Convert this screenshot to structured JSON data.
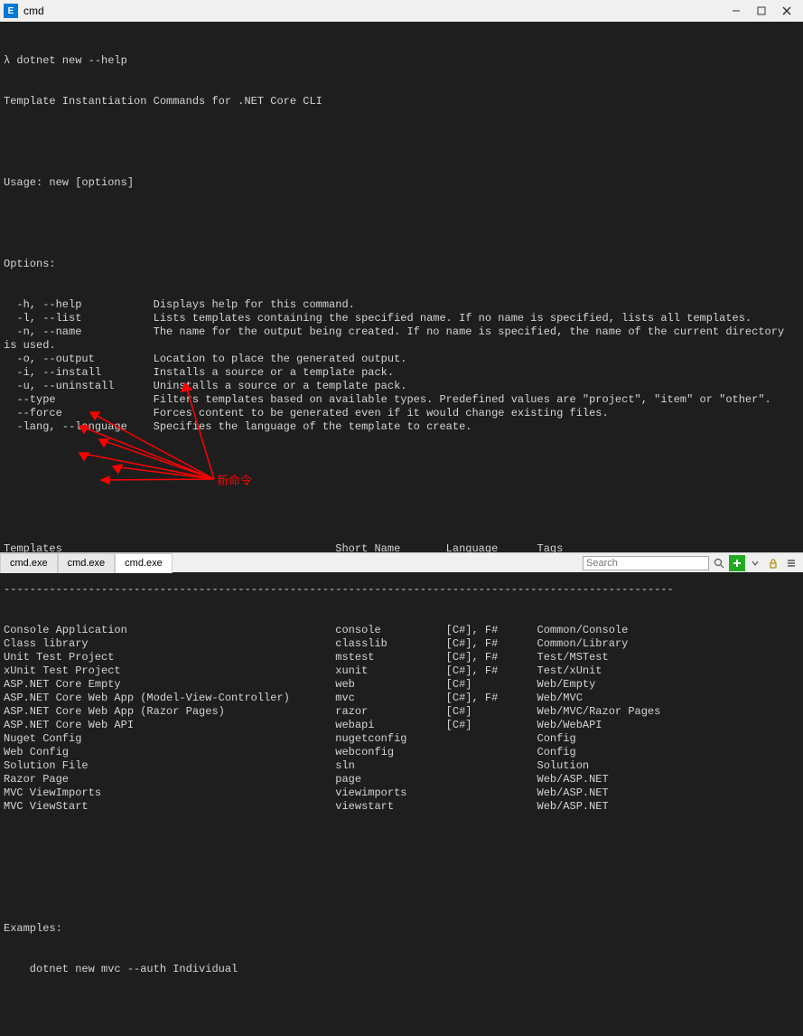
{
  "window": {
    "title": "cmd"
  },
  "prompt": "λ dotnet new --help",
  "header": "Template Instantiation Commands for .NET Core CLI",
  "usage": "Usage: new [options]",
  "options_hdr": "Options:",
  "options": [
    {
      "flag": "  -h, --help",
      "desc": "Displays help for this command."
    },
    {
      "flag": "  -l, --list",
      "desc": "Lists templates containing the specified name. If no name is specified, lists all templates."
    },
    {
      "flag": "  -n, --name",
      "desc": "The name for the output being created. If no name is specified, the name of the current directory"
    },
    {
      "flag": "is used.",
      "desc": ""
    },
    {
      "flag": "  -o, --output",
      "desc": "Location to place the generated output."
    },
    {
      "flag": "  -i, --install",
      "desc": "Installs a source or a template pack."
    },
    {
      "flag": "  -u, --uninstall",
      "desc": "Uninstalls a source or a template pack."
    },
    {
      "flag": "  --type",
      "desc": "Filters templates based on available types. Predefined values are \"project\", \"item\" or \"other\"."
    },
    {
      "flag": "  --force",
      "desc": "Forces content to be generated even if it would change existing files."
    },
    {
      "flag": "  -lang, --language",
      "desc": "Specifies the language of the template to create."
    }
  ],
  "table_hdr": {
    "c0": "Templates",
    "c1": "Short Name",
    "c2": "Language",
    "c3": "Tags"
  },
  "divider": "-------------------------------------------------------------------------------------------------------",
  "templates": [
    {
      "name": "Console Application",
      "short": "console",
      "lang": "[C#], F#",
      "tags": "Common/Console"
    },
    {
      "name": "Class library",
      "short": "classlib",
      "lang": "[C#], F#",
      "tags": "Common/Library"
    },
    {
      "name": "Unit Test Project",
      "short": "mstest",
      "lang": "[C#], F#",
      "tags": "Test/MSTest"
    },
    {
      "name": "xUnit Test Project",
      "short": "xunit",
      "lang": "[C#], F#",
      "tags": "Test/xUnit"
    },
    {
      "name": "ASP.NET Core Empty",
      "short": "web",
      "lang": "[C#]",
      "tags": "Web/Empty"
    },
    {
      "name": "ASP.NET Core Web App (Model-View-Controller)",
      "short": "mvc",
      "lang": "[C#], F#",
      "tags": "Web/MVC"
    },
    {
      "name": "ASP.NET Core Web App (Razor Pages)",
      "short": "razor",
      "lang": "[C#]",
      "tags": "Web/MVC/Razor Pages"
    },
    {
      "name": "ASP.NET Core Web API",
      "short": "webapi",
      "lang": "[C#]",
      "tags": "Web/WebAPI"
    },
    {
      "name": "Nuget Config",
      "short": "nugetconfig",
      "lang": "",
      "tags": "Config"
    },
    {
      "name": "Web Config",
      "short": "webconfig",
      "lang": "",
      "tags": "Config"
    },
    {
      "name": "Solution File",
      "short": "sln",
      "lang": "",
      "tags": "Solution"
    },
    {
      "name": "Razor Page",
      "short": "page",
      "lang": "",
      "tags": "Web/ASP.NET"
    },
    {
      "name": "MVC ViewImports",
      "short": "viewimports",
      "lang": "",
      "tags": "Web/ASP.NET"
    },
    {
      "name": "MVC ViewStart",
      "short": "viewstart",
      "lang": "",
      "tags": "Web/ASP.NET"
    }
  ],
  "examples_hdr": "Examples:",
  "example_line": "    dotnet new mvc --auth Individual",
  "annotation": "新命令",
  "tabs": [
    {
      "label": "cmd.exe",
      "active": false
    },
    {
      "label": "cmd.exe",
      "active": false
    },
    {
      "label": "cmd.exe",
      "active": true
    }
  ],
  "search": {
    "placeholder": "Search",
    "value": ""
  }
}
